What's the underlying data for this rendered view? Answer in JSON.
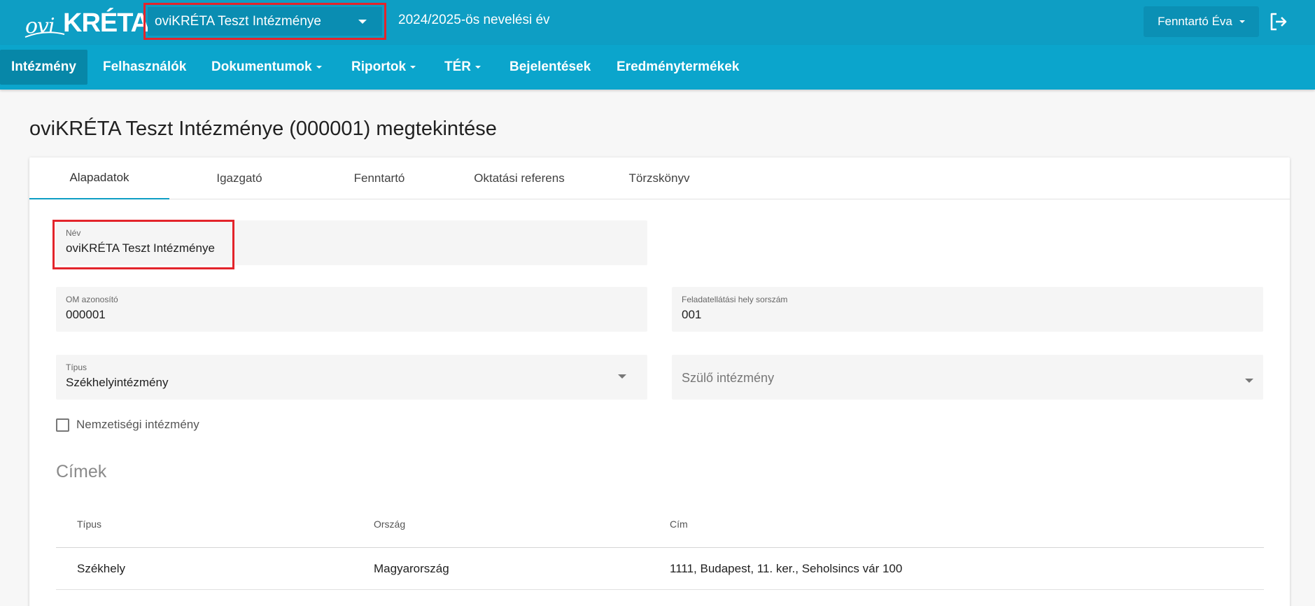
{
  "header": {
    "logo_ovi": "ovi",
    "logo_kreta": "KRÉTA",
    "institution_select": "oviKRÉTA Teszt Intézménye",
    "school_year": "2024/2025-ös nevelési év",
    "user": "Fenntartó Éva",
    "brand_color": "#0e9ec4"
  },
  "nav": {
    "items": [
      {
        "label": "Intézmény",
        "active": true,
        "dropdown": false
      },
      {
        "label": "Felhasználók",
        "dropdown": false
      },
      {
        "label": "Dokumentumok",
        "dropdown": true
      },
      {
        "label": "Riportok",
        "dropdown": true
      },
      {
        "label": "TÉR",
        "dropdown": true
      },
      {
        "label": "Bejelentések",
        "dropdown": false
      },
      {
        "label": "Eredménytermékek",
        "dropdown": false
      }
    ]
  },
  "page": {
    "title": "oviKRÉTA Teszt Intézménye (000001) megtekintése"
  },
  "tabs": [
    "Alapadatok",
    "Igazgató",
    "Fenntartó",
    "Oktatási referens",
    "Törzskönyv"
  ],
  "form": {
    "name_label": "Név",
    "name_value": "oviKRÉTA Teszt Intézménye",
    "om_label": "OM azonosító",
    "om_value": "000001",
    "site_label": "Feladatellátási hely sorszám",
    "site_value": "001",
    "type_label": "Típus",
    "type_value": "Székhelyintézmény",
    "parent_placeholder": "Szülő intézmény",
    "national_label": "Nemzetiségi intézmény",
    "national_checked": false
  },
  "addresses": {
    "title": "Címek",
    "columns": [
      "Típus",
      "Ország",
      "Cím"
    ],
    "rows": [
      [
        "Székhely",
        "Magyarország",
        "1111, Budapest, 11. ker., Seholsincs vár 100"
      ]
    ]
  }
}
